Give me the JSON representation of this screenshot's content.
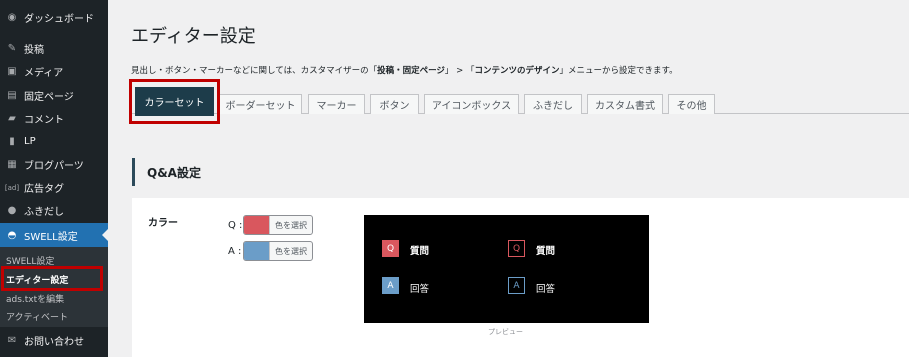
{
  "sidebar": {
    "items": [
      {
        "label": "ダッシュボード",
        "icon": "dashboard-icon",
        "glyph": "◉"
      },
      {
        "label": "投稿",
        "icon": "pin-icon",
        "glyph": "✎"
      },
      {
        "label": "メディア",
        "icon": "media-icon",
        "glyph": "▣"
      },
      {
        "label": "固定ページ",
        "icon": "page-icon",
        "glyph": "▤"
      },
      {
        "label": "コメント",
        "icon": "comment-icon",
        "glyph": "▰"
      },
      {
        "label": "LP",
        "icon": "document-icon",
        "glyph": "▮"
      },
      {
        "label": "ブログパーツ",
        "icon": "blocks-icon",
        "glyph": "▦"
      },
      {
        "label": "広告タグ",
        "icon": "ad-icon",
        "glyph": "[ad]"
      },
      {
        "label": "ふきだし",
        "icon": "speech-bubble-icon",
        "glyph": "●"
      },
      {
        "label": "SWELL設定",
        "icon": "swell-icon",
        "glyph": "◓"
      },
      {
        "label": "お問い合わせ",
        "icon": "mail-icon",
        "glyph": "✉"
      }
    ],
    "submenu": [
      "SWELL設定",
      "エディター設定",
      "ads.txtを編集",
      "アクティベート"
    ]
  },
  "page": {
    "title": "エディター設定",
    "desc_1": "見出し・ボタン・マーカーなどに関しては、カスタマイザーの「",
    "desc_2": "投稿・固定ページ",
    "desc_3": "」 > 「",
    "desc_4": "コンテンツのデザイン",
    "desc_5": "」メニューから設定できます。"
  },
  "tabs": [
    "カラーセット",
    "ボーダーセット",
    "マーカー",
    "ボタン",
    "アイコンボックス",
    "ふきだし",
    "カスタム書式",
    "その他"
  ],
  "section": {
    "title": "Q&A設定",
    "color_label": "カラー",
    "q_label": "Q :",
    "a_label": "A :",
    "picker_label": "色を選択",
    "q_color": "#d9575e",
    "a_color": "#6b9dc8"
  },
  "preview": {
    "q": "Q",
    "a": "A",
    "question": "質問",
    "answer": "回答",
    "caption": "プレビュー"
  }
}
